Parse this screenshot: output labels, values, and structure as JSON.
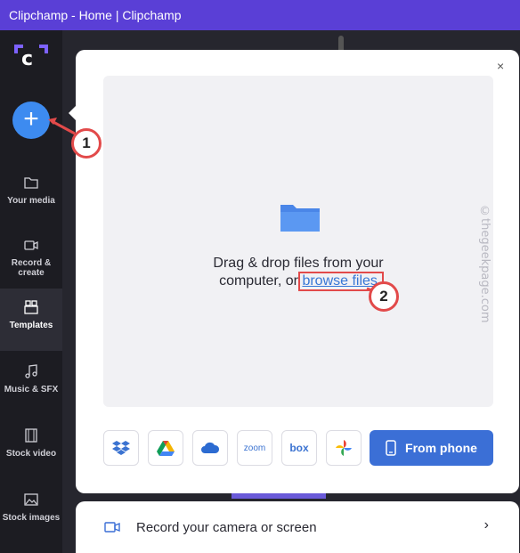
{
  "window": {
    "title": "Clipchamp - Home | Clipchamp"
  },
  "sidebar": {
    "add_label": "+",
    "items": [
      {
        "label": "Your media",
        "icon": "folder-icon"
      },
      {
        "label": "Record & create",
        "icon": "camera-icon"
      },
      {
        "label": "Templates",
        "icon": "templates-icon"
      },
      {
        "label": "Music & SFX",
        "icon": "music-icon"
      },
      {
        "label": "Stock video",
        "icon": "film-icon"
      },
      {
        "label": "Stock images",
        "icon": "image-icon"
      }
    ]
  },
  "modal": {
    "close_label": "×",
    "drop_text_line1": "Drag & drop files from your",
    "drop_text_line2_prefix": "computer, or ",
    "browse_link": "browse files",
    "sources": [
      {
        "name": "dropbox",
        "icon": "dropbox-icon"
      },
      {
        "name": "google-drive",
        "icon": "google-drive-icon"
      },
      {
        "name": "onedrive",
        "icon": "onedrive-icon"
      },
      {
        "name": "zoom",
        "label": "zoom"
      },
      {
        "name": "box",
        "label": "box"
      },
      {
        "name": "google-photos",
        "icon": "google-photos-icon"
      }
    ],
    "from_phone_label": "From phone"
  },
  "record_bar": {
    "label": "Record your camera or screen",
    "chevron": "›"
  },
  "watermark": "©thegeekpage.com",
  "callouts": [
    "1",
    "2"
  ],
  "colors": {
    "accent": "#3d8bf0",
    "titlebar": "#5a3fd6",
    "callout_border": "#e24a4a",
    "phone_button": "#3b6fd6"
  }
}
